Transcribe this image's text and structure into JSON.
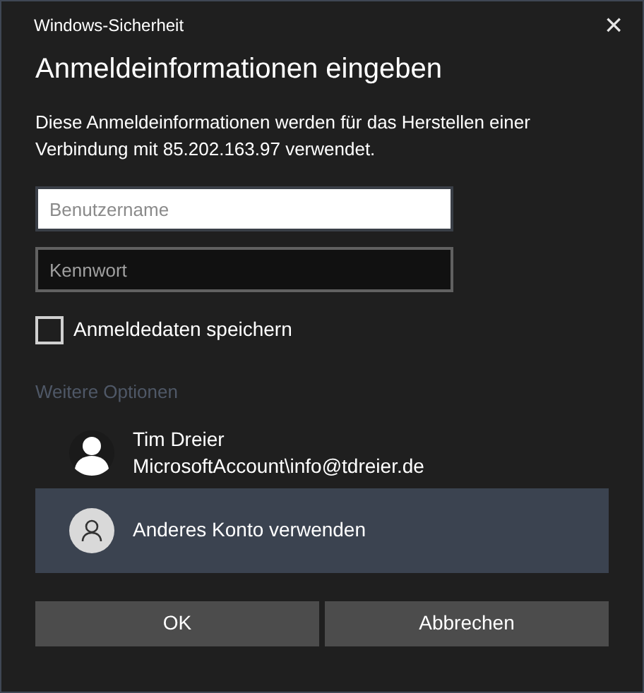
{
  "window": {
    "title": "Windows-Sicherheit",
    "close": "×"
  },
  "heading": "Anmeldeinformationen eingeben",
  "description": "Diese Anmeldeinformationen werden für das Herstellen einer Verbindung mit 85.202.163.97 verwendet.",
  "fields": [
    {
      "placeholder": "Benutzername",
      "focused": true
    },
    {
      "placeholder": "Kennwort",
      "focused": false
    }
  ],
  "remember": {
    "label": "Anmeldedaten speichern",
    "checked": false
  },
  "more_options": "Weitere Optionen",
  "accounts": [
    {
      "kind": "user",
      "name": "Tim Dreier",
      "detail": "MicrosoftAccount\\info@tdreier.de",
      "selected": false
    },
    {
      "kind": "other",
      "name": "Anderes Konto verwenden",
      "selected": true
    }
  ],
  "buttons": [
    "OK",
    "Abbrechen"
  ]
}
